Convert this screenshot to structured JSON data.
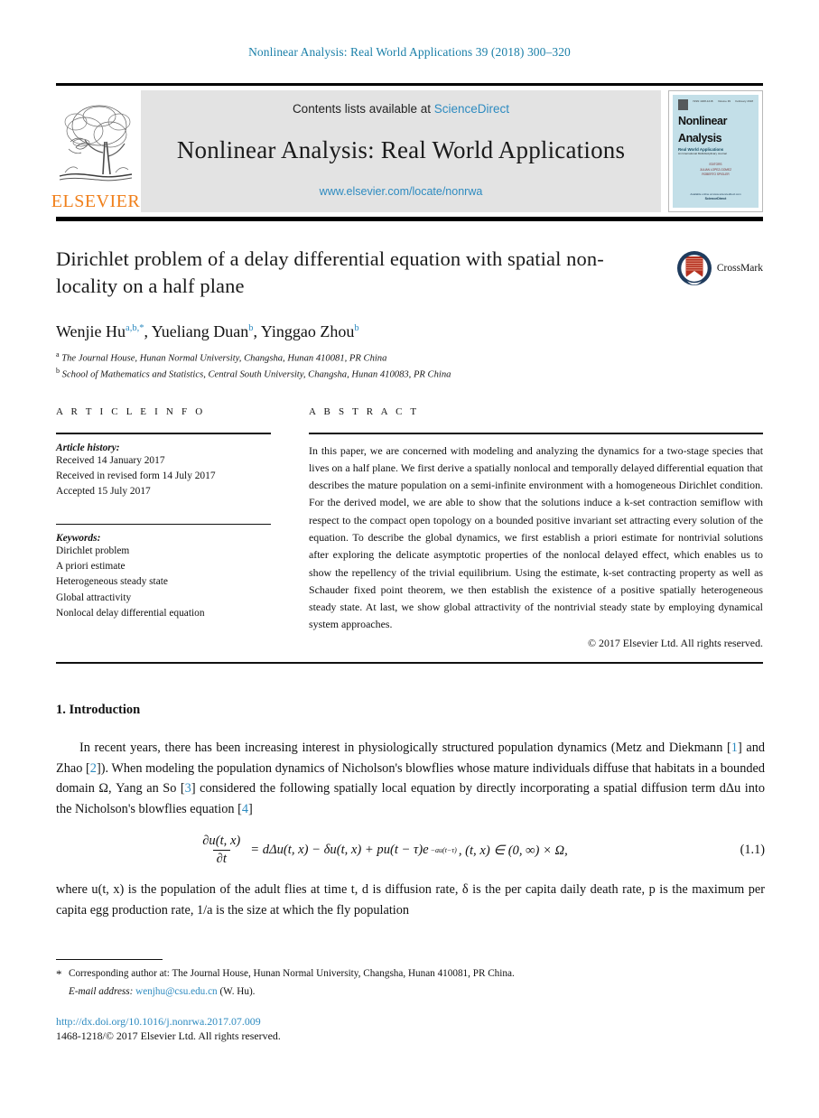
{
  "running_head": "Nonlinear Analysis: Real World Applications 39 (2018) 300–320",
  "masthead": {
    "publisher_name": "ELSEVIER",
    "contents_prefix": "Contents lists available at ",
    "contents_link": "ScienceDirect",
    "journal_title": "Nonlinear Analysis: Real World Applications",
    "journal_url": "www.elsevier.com/locate/nonrwa",
    "cover": {
      "issn_tiny": "ISSN 1468-1218",
      "volume_tiny": "Volume 39",
      "date_tiny": "February 2018",
      "title_line1": "Nonlinear",
      "title_line2": "Analysis",
      "subtitle": "Real World Applications",
      "series_note": "An International Multidisciplinary Journal",
      "editors_label": "EDITORS",
      "editor1": "JULIAN LOPEZ-GOMEZ",
      "editor2": "ROBERTO SPIGLER",
      "footer_note": "Available online at www.sciencedirect.com",
      "sd_mark": "ScienceDirect"
    }
  },
  "article": {
    "title": "Dirichlet problem of a delay differential equation with spatial non-locality on a half plane",
    "crossmark_label": "CrossMark",
    "authors": [
      {
        "name": "Wenjie Hu",
        "marks": "a,b,*"
      },
      {
        "name": "Yueliang Duan",
        "marks": "b"
      },
      {
        "name": "Yinggao Zhou",
        "marks": "b"
      }
    ],
    "affiliations": [
      {
        "mark": "a",
        "text": "The Journal House, Hunan Normal University, Changsha, Hunan 410081, PR China"
      },
      {
        "mark": "b",
        "text": "School of Mathematics and Statistics, Central South University, Changsha, Hunan 410083, PR China"
      }
    ]
  },
  "article_info": {
    "heading": "A R T I C L E   I N F O",
    "history_label": "Article history:",
    "history": [
      "Received 14 January 2017",
      "Received in revised form 14 July 2017",
      "Accepted 15 July 2017"
    ],
    "keywords_label": "Keywords:",
    "keywords": [
      "Dirichlet problem",
      "A priori estimate",
      "Heterogeneous steady state",
      "Global attractivity",
      "Nonlocal delay differential equation"
    ]
  },
  "abstract": {
    "heading": "A B S T R A C T",
    "text": "In this paper, we are concerned with modeling and analyzing the dynamics for a two-stage species that lives on a half plane. We first derive a spatially nonlocal and temporally delayed differential equation that describes the mature population on a semi-infinite environment with a homogeneous Dirichlet condition. For the derived model, we are able to show that the solutions induce a k-set contraction semiflow with respect to the compact open topology on a bounded positive invariant set attracting every solution of the equation. To describe the global dynamics, we first establish a priori estimate for nontrivial solutions after exploring the delicate asymptotic properties of the nonlocal delayed effect, which enables us to show the repellency of the trivial equilibrium. Using the estimate, k-set contracting property as well as Schauder fixed point theorem, we then establish the existence of a positive spatially heterogeneous steady state. At last, we show global attractivity of the nontrivial steady state by employing dynamical system approaches.",
    "copyright": "© 2017 Elsevier Ltd. All rights reserved."
  },
  "body": {
    "section_number_title": "1. Introduction",
    "paragraph1_part1": "In recent years, there has been increasing interest in physiologically structured population dynamics (Metz and Diekmann [",
    "cite1": "1",
    "paragraph1_part2": "] and Zhao [",
    "cite2": "2",
    "paragraph1_part3": "]). When modeling the population dynamics of Nicholson's blowflies whose mature individuals diffuse that habitats in a bounded domain Ω, Yang an So [",
    "cite3": "3",
    "paragraph1_part4": "] considered the following spatially local equation by directly incorporating a spatial diffusion term dΔu into the Nicholson's blowflies equation [",
    "cite4": "4",
    "paragraph1_part5": "]",
    "equation": {
      "numerator": "∂u(t, x)",
      "denominator": "∂t",
      "rhs": "= dΔu(t, x) − δu(t, x) + pu(t − τ)e",
      "exponent": "−au(t−τ)",
      "domain": ",   (t, x) ∈ (0, ∞) × Ω,",
      "number": "(1.1)"
    },
    "paragraph2": "where u(t, x) is the population of the adult flies at time t, d is diffusion rate, δ is the per capita daily death rate, p is the maximum per capita egg production rate, 1/a is the size at which the fly population"
  },
  "footnotes": {
    "corresponding": "Corresponding author at: The Journal House, Hunan Normal University, Changsha, Hunan 410081, PR China.",
    "email_label": "E-mail address:",
    "email": "wenjhu@csu.edu.cn",
    "email_owner": "(W. Hu).",
    "doi": "http://dx.doi.org/10.1016/j.nonrwa.2017.07.009",
    "issn_copyright": "1468-1218/© 2017 Elsevier Ltd. All rights reserved."
  }
}
